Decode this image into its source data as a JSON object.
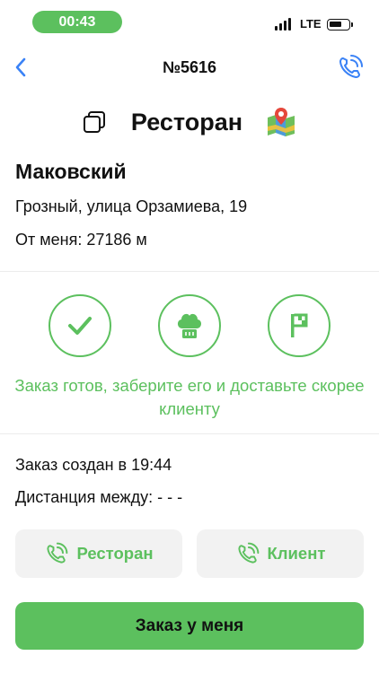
{
  "status_bar": {
    "time": "00:43",
    "network": "LTE",
    "battery_level": 0.7
  },
  "nav": {
    "title": "№5616"
  },
  "venue": {
    "title": "Ресторан"
  },
  "customer": {
    "name": "Маковский",
    "address": "Грозный, улица Орзамиева, 19",
    "distance": "От меня: 27186 м"
  },
  "steps": [
    {
      "name": "check-icon",
      "state": "done"
    },
    {
      "name": "chef-hat-icon",
      "state": "idle"
    },
    {
      "name": "flag-icon",
      "state": "idle"
    }
  ],
  "status_message": "Заказ готов, заберите его и доставьте скорее клиенту",
  "order_info": {
    "created": "Заказ создан в 19:44",
    "distance_between": "Дистанция между: - - -"
  },
  "call_buttons": {
    "restaurant": "Ресторан",
    "client": "Клиент"
  },
  "primary_button": {
    "label": "Заказ у меня"
  },
  "colors": {
    "accent": "#5cc05e",
    "button_bg": "#f2f2f2",
    "nav_icon": "#3a82f6"
  }
}
